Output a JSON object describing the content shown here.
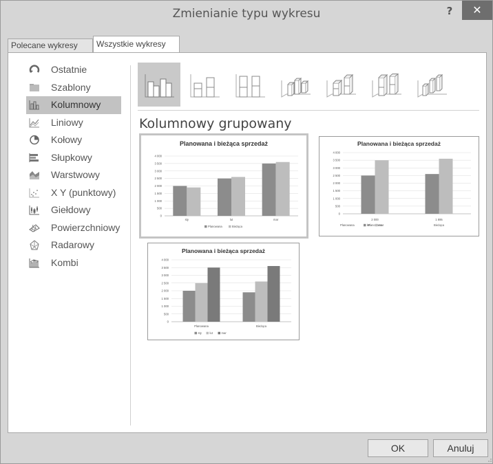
{
  "window": {
    "title": "Zmienianie typu wykresu",
    "help": "?",
    "close": "✕"
  },
  "tabs": [
    {
      "label": "Polecane wykresy",
      "active": false
    },
    {
      "label": "Wszystkie wykresy",
      "active": true
    }
  ],
  "sidebar": {
    "items": [
      {
        "label": "Ostatnie",
        "icon": "recent-icon"
      },
      {
        "label": "Szablony",
        "icon": "folder-icon"
      },
      {
        "label": "Kolumnowy",
        "icon": "column-chart-icon",
        "selected": true
      },
      {
        "label": "Liniowy",
        "icon": "line-chart-icon"
      },
      {
        "label": "Kołowy",
        "icon": "pie-chart-icon"
      },
      {
        "label": "Słupkowy",
        "icon": "bar-chart-icon"
      },
      {
        "label": "Warstwowy",
        "icon": "area-chart-icon"
      },
      {
        "label": "X Y (punktowy)",
        "icon": "scatter-chart-icon"
      },
      {
        "label": "Giełdowy",
        "icon": "stock-chart-icon"
      },
      {
        "label": "Powierzchniowy",
        "icon": "surface-chart-icon"
      },
      {
        "label": "Radarowy",
        "icon": "radar-chart-icon"
      },
      {
        "label": "Kombi",
        "icon": "combo-chart-icon"
      }
    ]
  },
  "subtypes": [
    {
      "name": "clustered-column-icon",
      "selected": true
    },
    {
      "name": "stacked-column-icon"
    },
    {
      "name": "100-stacked-column-icon"
    },
    {
      "name": "3d-clustered-column-icon"
    },
    {
      "name": "3d-stacked-column-icon"
    },
    {
      "name": "3d-100-stacked-column-icon"
    },
    {
      "name": "3d-column-icon"
    }
  ],
  "section_title": "Kolumnowy grupowany",
  "buttons": {
    "ok": "OK",
    "cancel": "Anuluj"
  },
  "chart_data": [
    {
      "type": "bar",
      "title": "Planowana i bieżąca sprzedaż",
      "categories": [
        "sty",
        "lut",
        "mar"
      ],
      "series": [
        {
          "name": "Planowana",
          "values": [
            2000,
            2500,
            3500
          ]
        },
        {
          "name": "Bieżąca",
          "values": [
            1900,
            2600,
            3600
          ]
        }
      ],
      "ylim": [
        0,
        4000
      ],
      "yticks": [
        "0",
        "500",
        "1 000",
        "1 500",
        "2 000",
        "2 500",
        "3 000",
        "3 500",
        "4 000"
      ],
      "legend": "bottom",
      "colors": [
        "#8c8c8c",
        "#bdbdbd"
      ]
    },
    {
      "type": "bar",
      "title": "Planowana i bieżąca sprzedaż",
      "categories": [
        "2 000",
        "1 895"
      ],
      "category_sublabels": [
        "Planowana",
        "Bieżąca"
      ],
      "series": [
        {
          "name": "lut",
          "values": [
            2500,
            2600
          ]
        },
        {
          "name": "mar",
          "values": [
            3500,
            3600
          ]
        }
      ],
      "ylim": [
        0,
        4000
      ],
      "yticks": [
        "0",
        "500",
        "1 000",
        "1 500",
        "2 000",
        "2 500",
        "3 000",
        "3 500",
        "4 000"
      ],
      "legend": "bottom",
      "legend_prefix": "Planowana",
      "colors": [
        "#8c8c8c",
        "#bdbdbd"
      ]
    },
    {
      "type": "bar",
      "title": "Planowana i bieżąca sprzedaż",
      "categories": [
        "Planowana",
        "Bieżąca"
      ],
      "series": [
        {
          "name": "sty",
          "values": [
            2000,
            1900
          ]
        },
        {
          "name": "lut",
          "values": [
            2500,
            2600
          ]
        },
        {
          "name": "mar",
          "values": [
            3500,
            3600
          ]
        }
      ],
      "ylim": [
        0,
        4000
      ],
      "yticks": [
        "0",
        "500",
        "1 000",
        "1 500",
        "2 000",
        "2 500",
        "3 000",
        "3 500",
        "4 000"
      ],
      "legend": "bottom",
      "colors": [
        "#8c8c8c",
        "#bdbdbd",
        "#7a7a7a"
      ]
    }
  ]
}
